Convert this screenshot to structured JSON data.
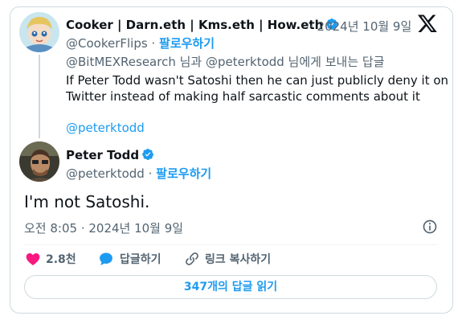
{
  "quoted_tweet": {
    "author_name": "Cooker | Darn.eth | Kms.eth | How.eth",
    "date": "· 2024년 10월 9일",
    "handle": "@CookerFlips",
    "follow_label": "팔로우하기",
    "reply_to": "@BitMEXResearch 님과 @peterktodd 님에게 보내는 답글",
    "text_line1": "If Peter Todd wasn't Satoshi then he can just publicly deny it on",
    "text_line2": "Twitter instead of making half sarcastic comments about it",
    "mention": "@peterktodd"
  },
  "main_tweet": {
    "author_name": "Peter Todd",
    "handle": "@peterktodd",
    "follow_label": "팔로우하기",
    "text": "I'm not Satoshi.",
    "timestamp": "오전 8:05 · 2024년 10월 9일"
  },
  "actions": {
    "like_count": "2.8천",
    "reply_label": "답글하기",
    "copy_link_label": "링크 복사하기"
  },
  "read_replies_label": "347개의 답글 읽기",
  "colors": {
    "accent": "#1d9bf0",
    "like": "#f91880",
    "verified": "#1d9bf0"
  },
  "icons": [
    "x-logo-icon",
    "verified-badge-icon",
    "heart-icon",
    "reply-bubble-icon",
    "link-icon",
    "info-icon"
  ]
}
